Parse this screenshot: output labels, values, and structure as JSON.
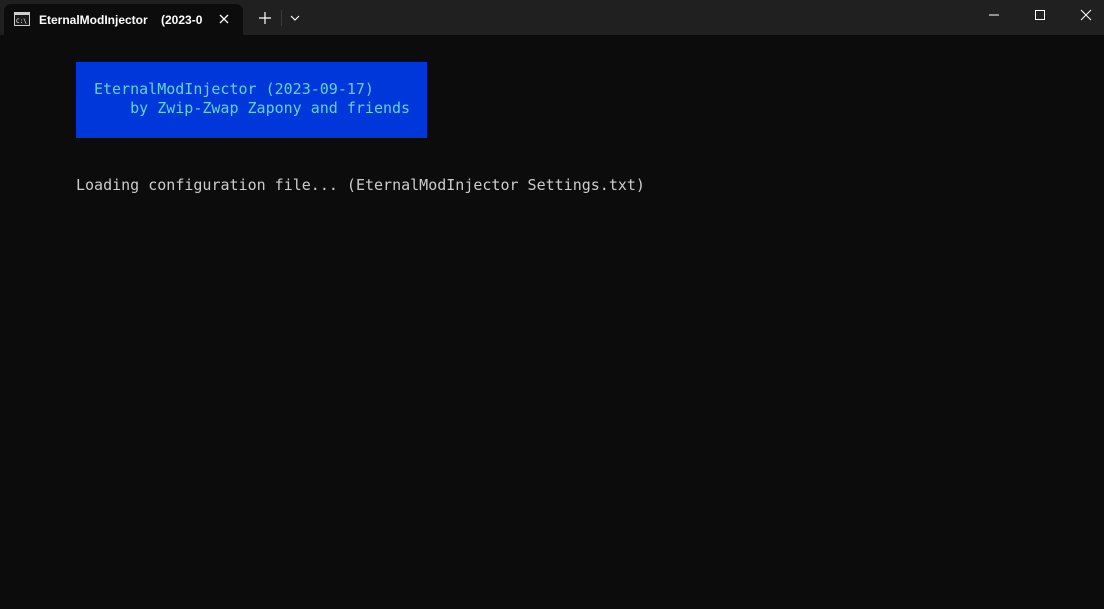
{
  "window": {
    "tab_title": "EternalModInjector    (2023-0",
    "tab_icon": "command-prompt-icon",
    "new_tab_icon": "plus-icon",
    "dropdown_icon": "chevron-down-icon",
    "minimize_icon": "minimize-icon",
    "maximize_icon": "maximize-icon",
    "close_icon": "close-icon"
  },
  "terminal": {
    "banner_line1": "EternalModInjector (2023-09-17)",
    "banner_line2": "    by Zwip-Zwap Zapony and friends",
    "output_line1": "Loading configuration file... (EternalModInjector Settings.txt)"
  },
  "colors": {
    "titlebar": "#202020",
    "terminal_bg": "#0c0c0c",
    "banner_bg": "#0037da",
    "banner_text": "#61d6d6",
    "output_text": "#cccccc"
  }
}
